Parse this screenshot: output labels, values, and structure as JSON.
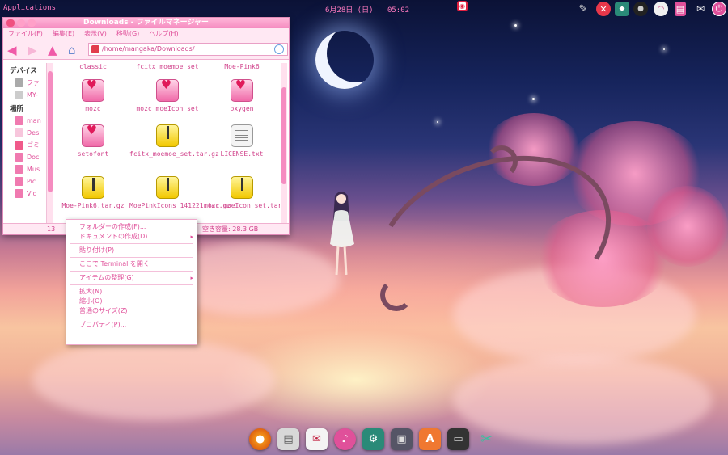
{
  "top_panel": {
    "apps_label": "Applications",
    "date": "6月28日 (日)",
    "time": "05:02"
  },
  "panel_icons": [
    "pen-icon",
    "close-icon",
    "android-icon",
    "camera-icon",
    "wifi-icon",
    "clipboard-icon",
    "mail-icon",
    "power-icon"
  ],
  "window": {
    "title": "Downloads - ファイルマネージャー",
    "menu": [
      "ファイル(F)",
      "編集(E)",
      "表示(V)",
      "移動(G)",
      "ヘルプ(H)"
    ],
    "address": "/home/mangaka/Downloads/",
    "sidebar": {
      "devices_heading": "デバイス",
      "devices": [
        "ファ",
        "MY-"
      ],
      "places_heading": "場所",
      "places": [
        "man",
        "Des",
        "ゴミ",
        "Doc",
        "Mus",
        "Pic",
        "Vid"
      ]
    },
    "files": [
      {
        "name": "classic",
        "icon": "heart-folder-icon"
      },
      {
        "name": "fcitx_moemoe_set",
        "icon": "heart-folder-icon"
      },
      {
        "name": "Moe-Pink6",
        "icon": "heart-folder-icon"
      },
      {
        "name": "mozc",
        "icon": "heart-folder-icon"
      },
      {
        "name": "mozc_moeIcon_set",
        "icon": "heart-folder-icon"
      },
      {
        "name": "oxygen",
        "icon": "heart-folder-icon"
      },
      {
        "name": "setofont",
        "icon": "heart-folder-icon"
      },
      {
        "name": "fcitx_moemoe_set.tar.gz",
        "icon": "archive-icon"
      },
      {
        "name": "LICENSE.txt",
        "icon": "text-file-icon"
      },
      {
        "name": "Moe-Pink6.tar.gz",
        "icon": "archive-icon"
      },
      {
        "name": "MoePinkIcons_141221.tar.gz",
        "icon": "archive-icon"
      },
      {
        "name": "mozc_moeIcon_set.tar.gz",
        "icon": "archive-icon"
      }
    ],
    "status_left": "13",
    "status_free": "空き容量: 28.3 GB"
  },
  "context_menu": {
    "items": [
      {
        "label": "フォルダーの作成(F)...",
        "submenu": false
      },
      {
        "label": "ドキュメントの作成(D)",
        "submenu": true
      },
      {
        "label": "貼り付け(P)",
        "submenu": false
      },
      {
        "label": "ここで Terminal を開く",
        "submenu": false
      },
      {
        "label": "アイテムの整理(G)",
        "submenu": true
      },
      {
        "label": "拡大(N)",
        "submenu": false
      },
      {
        "label": "縮小(O)",
        "submenu": false
      },
      {
        "label": "普通のサイズ(Z)",
        "submenu": false
      },
      {
        "label": "プロパティ(P)...",
        "submenu": false
      }
    ],
    "submenu_glyph": "▸"
  },
  "dock": [
    "firefox-icon",
    "printer-icon",
    "mail-icon",
    "music-icon",
    "settings-icon",
    "photos-icon",
    "appstore-icon",
    "monitor-icon",
    "scissors-icon"
  ],
  "colors": {
    "accent": "#f05aa8",
    "text_pink": "#e0509a",
    "titlebar": "#f58cc0"
  }
}
